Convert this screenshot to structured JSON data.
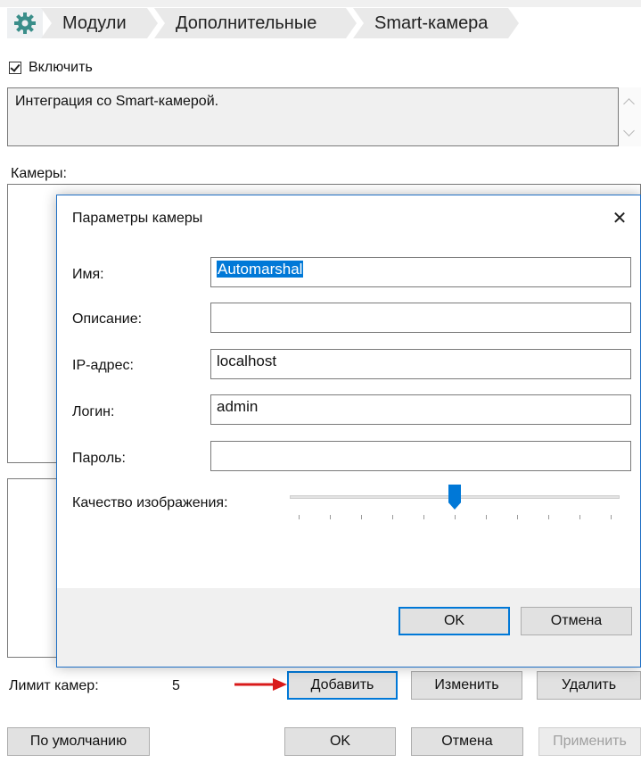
{
  "breadcrumb": {
    "items": [
      "Модули",
      "Дополнительные",
      "Smart-камера"
    ]
  },
  "module": {
    "enable_label": "Включить",
    "enabled": true,
    "description": "Интеграция со Smart-камерой.",
    "cameras_label": "Камеры:",
    "limit_label": "Лимит камер:",
    "limit_value": "5"
  },
  "buttons": {
    "add": "Добавить",
    "edit": "Изменить",
    "delete": "Удалить",
    "defaults": "По умолчанию",
    "ok": "OK",
    "cancel": "Отмена",
    "apply": "Применить"
  },
  "dialog": {
    "title": "Параметры камеры",
    "close_glyph": "✕",
    "name_label": "Имя:",
    "name_value": "Automarshal",
    "desc_label": "Описание:",
    "desc_value": "",
    "ip_label": "IP-адрес:",
    "ip_value": "localhost",
    "login_label": "Логин:",
    "login_value": "admin",
    "password_label": "Пароль:",
    "password_value": "",
    "quality_label": "Качество изображения:",
    "quality_value": 0.5,
    "ok": "OK",
    "cancel": "Отмена"
  },
  "colors": {
    "accent": "#0078d7",
    "arrow": "#d91a1a",
    "gear": "#3a8e8a"
  }
}
